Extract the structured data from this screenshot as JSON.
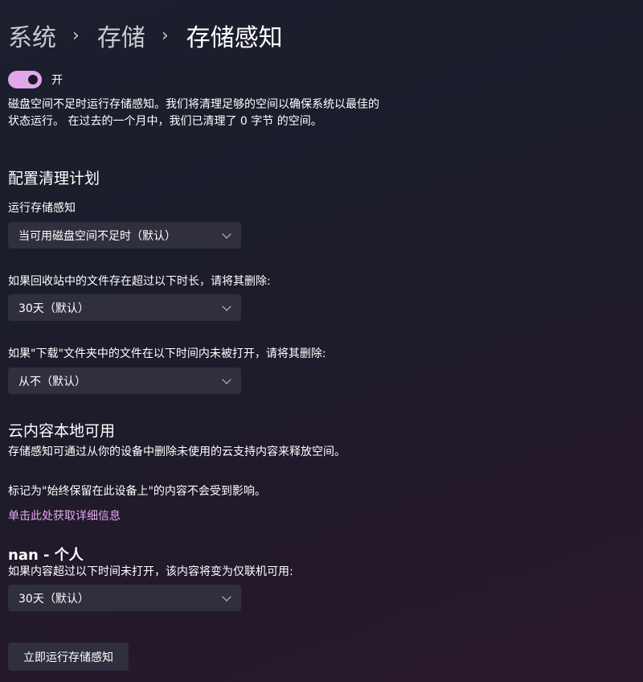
{
  "breadcrumb": {
    "items": [
      "系统",
      "存储",
      "存储感知"
    ],
    "separator": "›"
  },
  "toggle": {
    "state": "开",
    "on": true,
    "color": "#e2a6ea"
  },
  "description": "磁盘空间不足时运行存储感知。我们将清理足够的空间以确保系统以最佳的状态运行。 在过去的一个月中，我们已清理了 0 字节 的空间。",
  "cleanup": {
    "title": "配置清理计划",
    "run_label": "运行存储感知",
    "run_value": "当可用磁盘空间不足时（默认）",
    "recycle_label": "如果回收站中的文件存在超过以下时长，请将其删除:",
    "recycle_value": "30天（默认）",
    "downloads_label": "如果\"下载\"文件夹中的文件在以下时间内未被打开，请将其删除:",
    "downloads_value": "从不（默认）"
  },
  "cloud": {
    "title": "云内容本地可用",
    "desc1": "存储感知可通过从你的设备中删除未使用的云支持内容来释放空间。",
    "desc2": "标记为\"始终保留在此设备上\"的内容不会受到影响。",
    "link": "单击此处获取详细信息",
    "link_color": "#e6a7ef",
    "account_title": "nan - 个人",
    "account_label": "如果内容超过以下时间未打开，该内容将变为仅联机可用:",
    "account_value": "30天（默认）"
  },
  "actions": {
    "run_now": "立即运行存储感知"
  }
}
